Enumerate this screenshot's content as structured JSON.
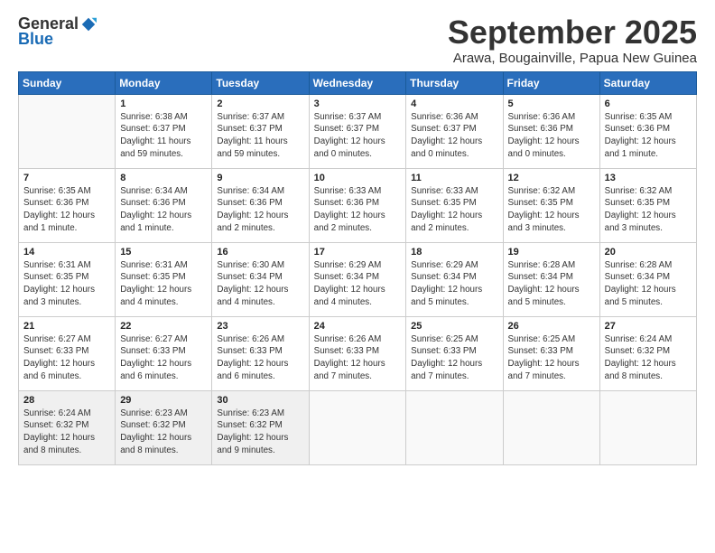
{
  "header": {
    "logo_general": "General",
    "logo_blue": "Blue",
    "month_title": "September 2025",
    "location": "Arawa, Bougainville, Papua New Guinea"
  },
  "days_of_week": [
    "Sunday",
    "Monday",
    "Tuesday",
    "Wednesday",
    "Thursday",
    "Friday",
    "Saturday"
  ],
  "weeks": [
    [
      {
        "day": "",
        "info": ""
      },
      {
        "day": "1",
        "info": "Sunrise: 6:38 AM\nSunset: 6:37 PM\nDaylight: 11 hours\nand 59 minutes."
      },
      {
        "day": "2",
        "info": "Sunrise: 6:37 AM\nSunset: 6:37 PM\nDaylight: 11 hours\nand 59 minutes."
      },
      {
        "day": "3",
        "info": "Sunrise: 6:37 AM\nSunset: 6:37 PM\nDaylight: 12 hours\nand 0 minutes."
      },
      {
        "day": "4",
        "info": "Sunrise: 6:36 AM\nSunset: 6:37 PM\nDaylight: 12 hours\nand 0 minutes."
      },
      {
        "day": "5",
        "info": "Sunrise: 6:36 AM\nSunset: 6:36 PM\nDaylight: 12 hours\nand 0 minutes."
      },
      {
        "day": "6",
        "info": "Sunrise: 6:35 AM\nSunset: 6:36 PM\nDaylight: 12 hours\nand 1 minute."
      }
    ],
    [
      {
        "day": "7",
        "info": "Sunrise: 6:35 AM\nSunset: 6:36 PM\nDaylight: 12 hours\nand 1 minute."
      },
      {
        "day": "8",
        "info": "Sunrise: 6:34 AM\nSunset: 6:36 PM\nDaylight: 12 hours\nand 1 minute."
      },
      {
        "day": "9",
        "info": "Sunrise: 6:34 AM\nSunset: 6:36 PM\nDaylight: 12 hours\nand 2 minutes."
      },
      {
        "day": "10",
        "info": "Sunrise: 6:33 AM\nSunset: 6:36 PM\nDaylight: 12 hours\nand 2 minutes."
      },
      {
        "day": "11",
        "info": "Sunrise: 6:33 AM\nSunset: 6:35 PM\nDaylight: 12 hours\nand 2 minutes."
      },
      {
        "day": "12",
        "info": "Sunrise: 6:32 AM\nSunset: 6:35 PM\nDaylight: 12 hours\nand 3 minutes."
      },
      {
        "day": "13",
        "info": "Sunrise: 6:32 AM\nSunset: 6:35 PM\nDaylight: 12 hours\nand 3 minutes."
      }
    ],
    [
      {
        "day": "14",
        "info": "Sunrise: 6:31 AM\nSunset: 6:35 PM\nDaylight: 12 hours\nand 3 minutes."
      },
      {
        "day": "15",
        "info": "Sunrise: 6:31 AM\nSunset: 6:35 PM\nDaylight: 12 hours\nand 4 minutes."
      },
      {
        "day": "16",
        "info": "Sunrise: 6:30 AM\nSunset: 6:34 PM\nDaylight: 12 hours\nand 4 minutes."
      },
      {
        "day": "17",
        "info": "Sunrise: 6:29 AM\nSunset: 6:34 PM\nDaylight: 12 hours\nand 4 minutes."
      },
      {
        "day": "18",
        "info": "Sunrise: 6:29 AM\nSunset: 6:34 PM\nDaylight: 12 hours\nand 5 minutes."
      },
      {
        "day": "19",
        "info": "Sunrise: 6:28 AM\nSunset: 6:34 PM\nDaylight: 12 hours\nand 5 minutes."
      },
      {
        "day": "20",
        "info": "Sunrise: 6:28 AM\nSunset: 6:34 PM\nDaylight: 12 hours\nand 5 minutes."
      }
    ],
    [
      {
        "day": "21",
        "info": "Sunrise: 6:27 AM\nSunset: 6:33 PM\nDaylight: 12 hours\nand 6 minutes."
      },
      {
        "day": "22",
        "info": "Sunrise: 6:27 AM\nSunset: 6:33 PM\nDaylight: 12 hours\nand 6 minutes."
      },
      {
        "day": "23",
        "info": "Sunrise: 6:26 AM\nSunset: 6:33 PM\nDaylight: 12 hours\nand 6 minutes."
      },
      {
        "day": "24",
        "info": "Sunrise: 6:26 AM\nSunset: 6:33 PM\nDaylight: 12 hours\nand 7 minutes."
      },
      {
        "day": "25",
        "info": "Sunrise: 6:25 AM\nSunset: 6:33 PM\nDaylight: 12 hours\nand 7 minutes."
      },
      {
        "day": "26",
        "info": "Sunrise: 6:25 AM\nSunset: 6:33 PM\nDaylight: 12 hours\nand 7 minutes."
      },
      {
        "day": "27",
        "info": "Sunrise: 6:24 AM\nSunset: 6:32 PM\nDaylight: 12 hours\nand 8 minutes."
      }
    ],
    [
      {
        "day": "28",
        "info": "Sunrise: 6:24 AM\nSunset: 6:32 PM\nDaylight: 12 hours\nand 8 minutes."
      },
      {
        "day": "29",
        "info": "Sunrise: 6:23 AM\nSunset: 6:32 PM\nDaylight: 12 hours\nand 8 minutes."
      },
      {
        "day": "30",
        "info": "Sunrise: 6:23 AM\nSunset: 6:32 PM\nDaylight: 12 hours\nand 9 minutes."
      },
      {
        "day": "",
        "info": ""
      },
      {
        "day": "",
        "info": ""
      },
      {
        "day": "",
        "info": ""
      },
      {
        "day": "",
        "info": ""
      }
    ]
  ]
}
